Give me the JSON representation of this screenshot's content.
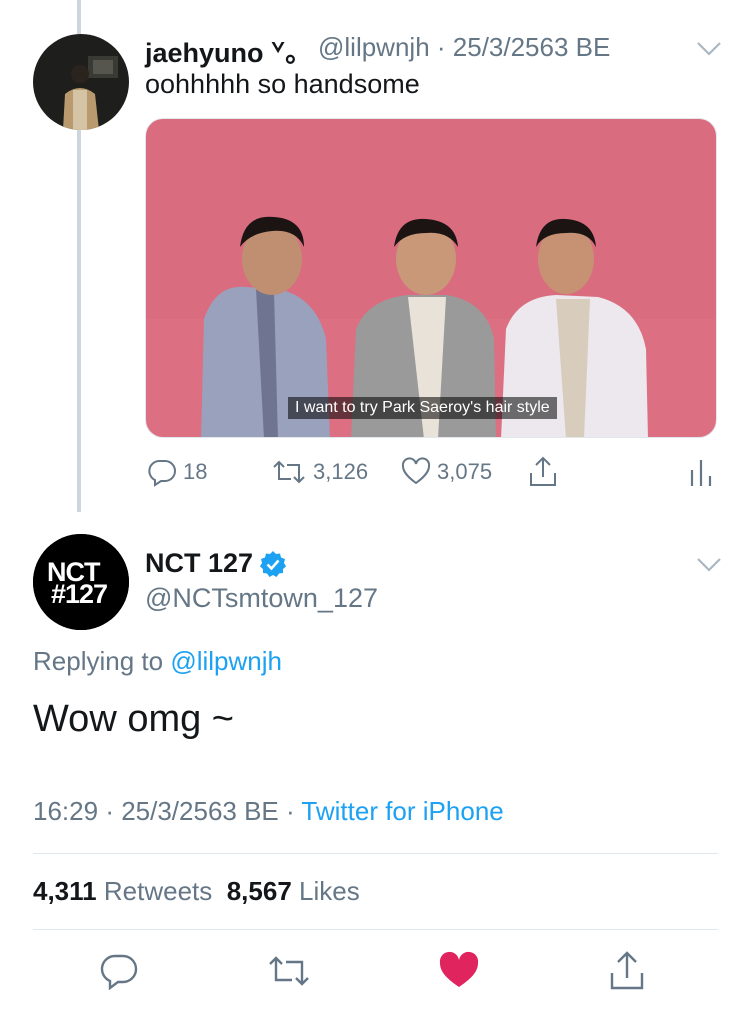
{
  "parent_tweet": {
    "display_name": "jaehyuno ᘁ。",
    "handle": "@lilpwnjh",
    "date": "· 25/3/2563 BE",
    "text": "oohhhhh so handsome",
    "media_subtitle": "I want to try Park Saeroy's hair style",
    "reply_count": "18",
    "retweet_count": "3,126",
    "like_count": "3,075"
  },
  "main_tweet": {
    "display_name": "NCT 127",
    "handle": "@NCTsmtown_127",
    "avatar_text_1": "NCT",
    "avatar_text_2": "#127",
    "replying_label": "Replying to",
    "replying_handle": "@lilpwnjh",
    "text": "Wow omg ~",
    "time": "16:29",
    "date": "· 25/3/2563 BE ·",
    "source": "Twitter for iPhone",
    "retweets_value": "4,311",
    "retweets_label": "Retweets",
    "likes_value": "8,567",
    "likes_label": "Likes"
  },
  "colors": {
    "accent": "#1da1f2",
    "like_red": "#e0245e",
    "secondary_text": "#657786",
    "media_background": "#dc6f82"
  },
  "icons": [
    "reply-icon",
    "retweet-icon",
    "like-icon",
    "share-icon",
    "analytics-icon",
    "chevron-down-icon",
    "verified-badge-icon"
  ]
}
